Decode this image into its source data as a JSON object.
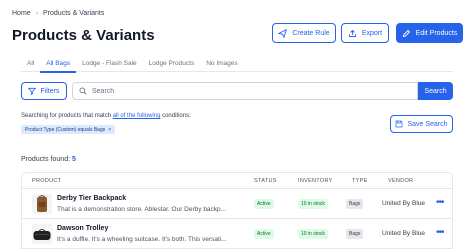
{
  "breadcrumb": {
    "home": "Home",
    "current": "Products & Variants"
  },
  "page": {
    "title": "Products & Variants"
  },
  "header_buttons": {
    "create_rule": "Create Rule",
    "export": "Export",
    "edit_products": "Edit Products"
  },
  "tabs": [
    {
      "label": "All",
      "active": false
    },
    {
      "label": "All Bags",
      "active": true
    },
    {
      "label": "Lodge - Flash Sale",
      "active": false
    },
    {
      "label": "Lodge Products",
      "active": false
    },
    {
      "label": "No Images",
      "active": false
    }
  ],
  "filters": {
    "label": "Filters"
  },
  "search": {
    "placeholder": "Search",
    "button_label": "Search"
  },
  "conditions": {
    "prefix": "Searching for products that match ",
    "link": "all of the following",
    "suffix": " conditions:",
    "chip": "Product Type (Custom) equals Bags"
  },
  "save_search": {
    "label": "Save Search"
  },
  "results": {
    "label": "Products found: ",
    "count": "5"
  },
  "table": {
    "columns": {
      "product": "PRODUCT",
      "status": "STATUS",
      "inventory": "INVENTORY",
      "type": "TYPE",
      "vendor": "VENDOR"
    },
    "rows": [
      {
        "name": "Derby Tier Backpack",
        "description": "That is a demonstration store. Ablestar. Our Derby backp...",
        "status": "Active",
        "inventory": "10 in stock",
        "type": "Bags",
        "vendor": "United By Blue",
        "thumb_color": "#8b5a2b"
      },
      {
        "name": "Dawson Trolley",
        "description": "It's a duffle. It's a wheeling suitcase. It's both. This versati...",
        "status": "Active",
        "inventory": "10 in stock",
        "type": "Bags",
        "vendor": "United By Blue",
        "thumb_color": "#1f1f1f"
      }
    ]
  },
  "colors": {
    "accent": "#2563eb",
    "active_badge_bg": "#dcfce7",
    "chip_bg": "#dbeafe"
  }
}
